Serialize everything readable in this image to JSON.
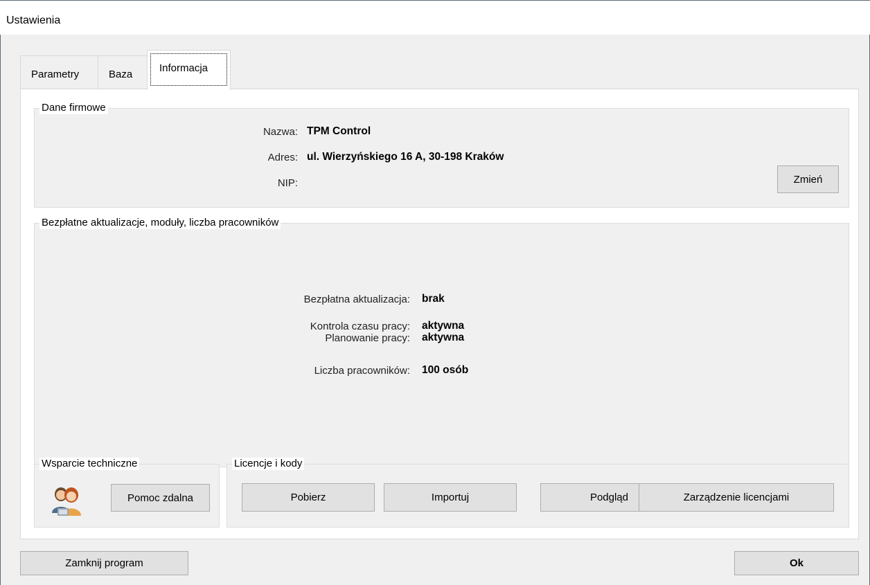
{
  "window": {
    "title": "Ustawienia"
  },
  "tabs": [
    {
      "label": "Parametry"
    },
    {
      "label": "Baza"
    },
    {
      "label": "Informacja",
      "active": true
    }
  ],
  "company": {
    "legend": "Dane firmowe",
    "name_label": "Nazwa:",
    "name_value": "TPM Control",
    "address_label": "Adres:",
    "address_value": "ul. Wierzyńskiego 16 A, 30-198 Kraków",
    "nip_label": "NIP:",
    "nip_value": "",
    "change_button": "Zmień"
  },
  "license_info": {
    "legend": "Bezpłatne aktualizacje, moduły, liczba pracowników",
    "free_update_label": "Bezpłatna aktualizacja:",
    "free_update_value": "brak",
    "time_control_label": "Kontrola czasu pracy:",
    "time_control_value": "aktywna",
    "planning_label": "Planowanie pracy:",
    "planning_value": "aktywna",
    "employees_label": "Liczba pracowników:",
    "employees_value": "100 osób"
  },
  "support": {
    "legend": "Wsparcie techniczne",
    "icon": "support-people-icon",
    "remote_help_button": "Pomoc zdalna"
  },
  "licenses": {
    "legend": "Licencje i kody",
    "download_button": "Pobierz",
    "import_button": "Importuj",
    "preview_button": "Podgląd",
    "manage_button": "Zarządzenie licencjami"
  },
  "footer": {
    "close_program_button": "Zamknij program",
    "ok_button": "Ok"
  },
  "colors": {
    "panel_bg": "#ffffff",
    "window_bg": "#f0f0f0",
    "button_bg": "#e1e1e1",
    "button_border": "#adadad"
  }
}
